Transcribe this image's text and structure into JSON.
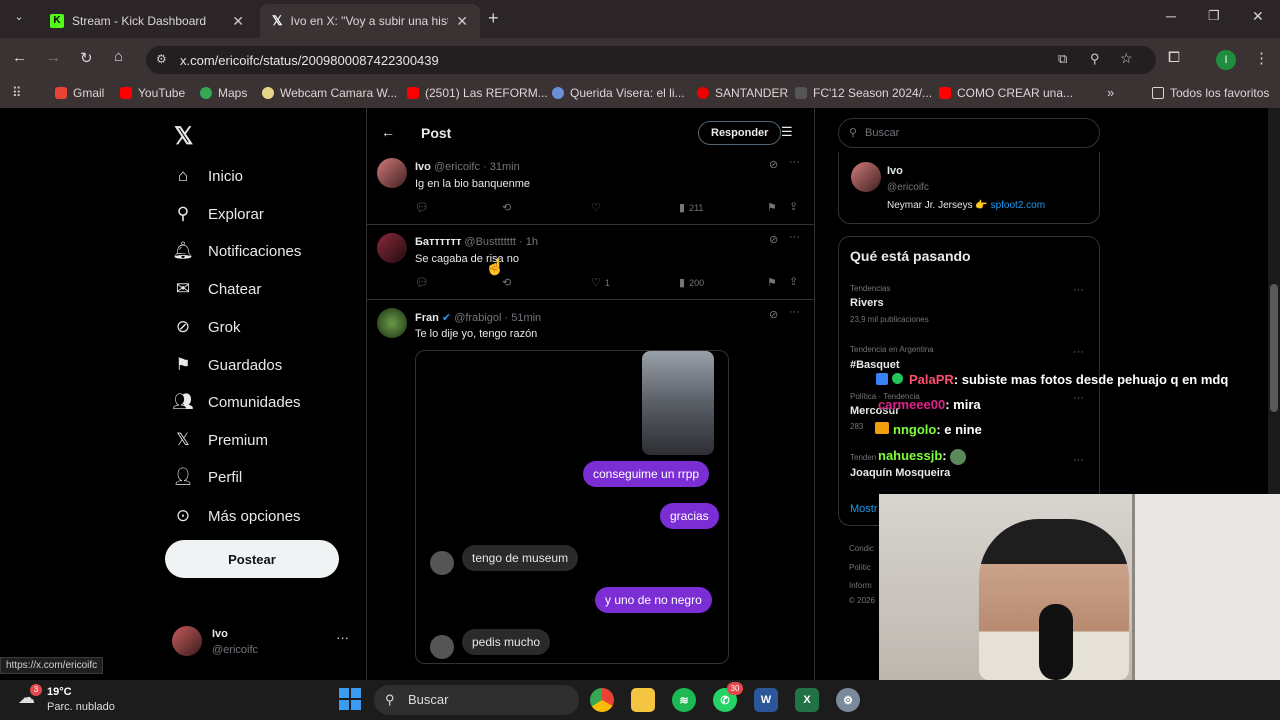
{
  "browser": {
    "tabs": [
      {
        "label": "Stream - Kick Dashboard",
        "favicon": "kick-icon",
        "active": false
      },
      {
        "label": "Ivo en X: \"Voy a subir una histo",
        "favicon": "x-icon",
        "active": true
      }
    ],
    "url": "x.com/ericoifc/status/2009800087422300439",
    "bookmarks": [
      "Gmail",
      "YouTube",
      "Maps",
      "Webcam Camara W...",
      "(2501) Las REFORM...",
      "Querida Visera: el li...",
      "SANTANDER",
      "FC'12 Season 2024/...",
      "COMO CREAR una..."
    ],
    "all_favorites": "Todos los favoritos",
    "status_url": "https://x.com/ericoifc"
  },
  "sidebar": {
    "items": [
      {
        "label": "Inicio",
        "icon": "home-icon"
      },
      {
        "label": "Explorar",
        "icon": "search-icon"
      },
      {
        "label": "Notificaciones",
        "icon": "bell-icon"
      },
      {
        "label": "Chatear",
        "icon": "mail-icon"
      },
      {
        "label": "Grok",
        "icon": "grok-icon"
      },
      {
        "label": "Guardados",
        "icon": "bookmark-icon"
      },
      {
        "label": "Comunidades",
        "icon": "people-icon"
      },
      {
        "label": "Premium",
        "icon": "x-icon"
      },
      {
        "label": "Perfil",
        "icon": "person-icon"
      },
      {
        "label": "Más opciones",
        "icon": "more-circle-icon"
      }
    ],
    "post_button": "Postear",
    "account": {
      "name": "Ivo",
      "handle": "@ericoifc"
    }
  },
  "header": {
    "title": "Post",
    "reply_button": "Responder"
  },
  "tweets": [
    {
      "name": "Ivo",
      "handle": "@ericoifc · 31min",
      "text": "Ig en la bio banquenme",
      "likes": "",
      "views": "211"
    },
    {
      "name": "Бaтттттт",
      "handle": "@Busttttttt · 1h",
      "text": "Se cagaba de risa no",
      "likes": "1",
      "views": "200"
    },
    {
      "name": "Fran",
      "handle": "@frabigol · 51min",
      "text": "Te lo dije yo, tengo razón"
    }
  ],
  "chat_bubbles": [
    {
      "text": "conseguime un rrpp",
      "from": "me"
    },
    {
      "text": "gracias",
      "from": "me"
    },
    {
      "text": "tengo de museum",
      "from": "them"
    },
    {
      "text": "y uno de no negro",
      "from": "me"
    },
    {
      "text": "pedis mucho",
      "from": "them"
    }
  ],
  "right": {
    "search_placeholder": "Buscar",
    "profile_card": {
      "name": "Ivo",
      "handle": "@ericoifc",
      "bio": "Neymar Jr. Jerseys 👉 ",
      "link": "spfoot2.com"
    },
    "trending_title": "Qué está pasando",
    "trends": [
      {
        "context": "Tendencias",
        "title": "Rivers",
        "count": "23,9 mil publicaciones"
      },
      {
        "context": "Tendencia en Argentina",
        "title": "#Basquet",
        "count": ""
      },
      {
        "context": "Política · Tendencia",
        "title": "Mercosur",
        "count": "283"
      },
      {
        "context": "Tenden",
        "title": "Joaquín Mosqueira",
        "count": ""
      }
    ],
    "show_more": "Mostr",
    "footer": [
      "Condic",
      "Polític",
      "Inform",
      "© 2026"
    ]
  },
  "stream_chat": [
    {
      "user": "PalaPR",
      "msg": ": subiste mas fotos desde pehuajo q en mdq",
      "color": "#ff4d6d"
    },
    {
      "user": "carmeee00",
      "msg": ": mira",
      "color": "#e0218a"
    },
    {
      "user": "nngolo",
      "msg": ": e nine",
      "color": "#7fff3a"
    },
    {
      "user": "nahuessjb",
      "msg": ": ",
      "color": "#7fff3a"
    }
  ],
  "taskbar": {
    "temp": "19°C",
    "weather": "Parc. nublado",
    "weather_badge": "3",
    "search": "Buscar",
    "whatsapp_badge": "30"
  }
}
